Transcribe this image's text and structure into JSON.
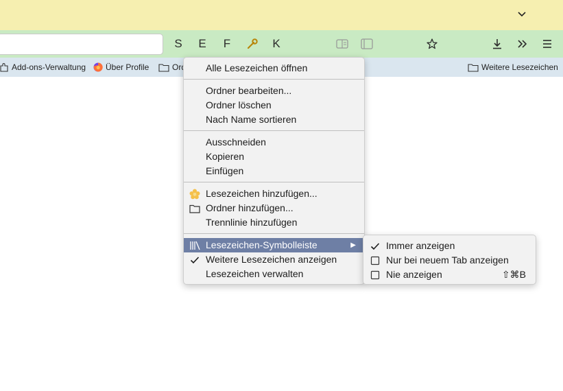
{
  "toolbar": {
    "s": "S",
    "e": "E",
    "f": "F",
    "k": "K"
  },
  "bookmarks_bar": {
    "items": [
      {
        "label": "Add-ons-Verwaltung",
        "icon": "puzzle-icon"
      },
      {
        "label": "Über Profile",
        "icon": "firefox-icon"
      },
      {
        "label": "Ord",
        "icon": "folder-icon"
      }
    ],
    "other": {
      "label": "Weitere Lesezeichen",
      "icon": "folder-icon"
    }
  },
  "context_menu": {
    "open_all": "Alle Lesezeichen öffnen",
    "edit_folder": "Ordner bearbeiten...",
    "delete_folder": "Ordner löschen",
    "sort_by_name": "Nach Name sortieren",
    "cut": "Ausschneiden",
    "copy": "Kopieren",
    "paste": "Einfügen",
    "add_bookmark": "Lesezeichen hinzufügen...",
    "add_folder": "Ordner hinzufügen...",
    "add_separator": "Trennlinie hinzufügen",
    "toolbar_item": "Lesezeichen-Symbolleiste",
    "show_other": "Weitere Lesezeichen anzeigen",
    "manage": "Lesezeichen verwalten"
  },
  "submenu": {
    "always": "Immer anzeigen",
    "new_tab_only": "Nur bei neuem Tab anzeigen",
    "never": "Nie anzeigen",
    "never_shortcut": "⇧⌘B"
  },
  "colors": {
    "titlebar": "#f6efb0",
    "navbar": "#c9eac3",
    "bookmarks_bar": "#dae6ef",
    "menu_highlight": "#6e7fa5"
  }
}
